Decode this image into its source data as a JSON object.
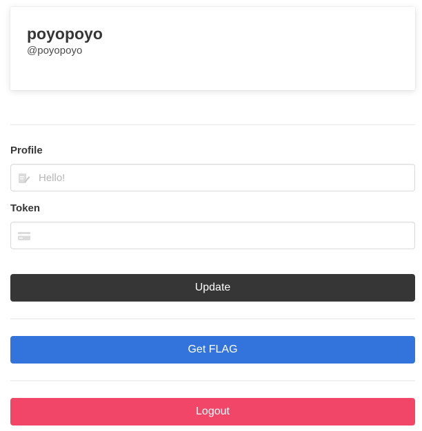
{
  "profile_card": {
    "display_name": "poyopoyo",
    "username": "@poyopoyo"
  },
  "form": {
    "profile_label": "Profile",
    "profile_placeholder": "Hello!",
    "profile_value": "",
    "profile_icon": "edit-icon",
    "token_label": "Token",
    "token_placeholder": "",
    "token_value": "",
    "token_icon": "credit-card-icon"
  },
  "buttons": {
    "update_label": "Update",
    "get_flag_label": "Get FLAG",
    "logout_label": "Logout"
  },
  "colors": {
    "dark": "#363636",
    "blue": "#3273dc",
    "red": "#f14668"
  }
}
